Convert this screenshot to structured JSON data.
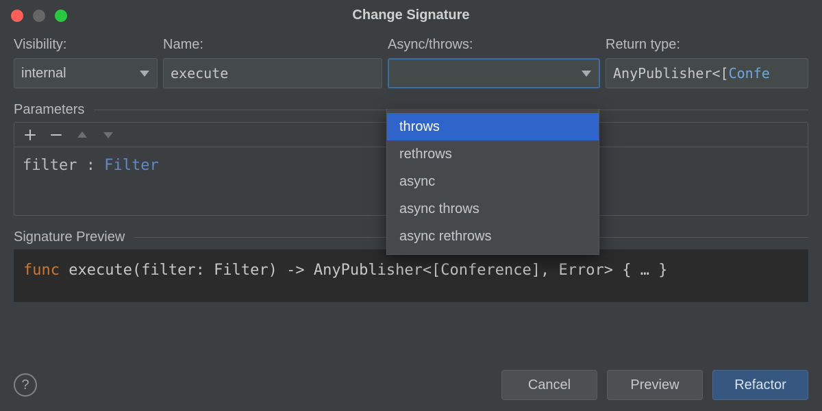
{
  "title": "Change Signature",
  "fields": {
    "visibility": {
      "label": "Visibility:",
      "value": "internal"
    },
    "name": {
      "label": "Name:",
      "value": "execute"
    },
    "async": {
      "label": "Async/throws:",
      "value": ""
    },
    "return": {
      "label": "Return type:",
      "value": "AnyPublisher<[Conference], Error>",
      "display": "AnyPublisher<[Confe"
    }
  },
  "async_options": [
    "throws",
    "rethrows",
    "async",
    "async throws",
    "async rethrows"
  ],
  "async_selected_index": 0,
  "sections": {
    "parameters": "Parameters",
    "preview": "Signature Preview"
  },
  "parameters": [
    {
      "name": "filter",
      "type": "Filter"
    }
  ],
  "preview": {
    "keyword": "func",
    "name": "execute",
    "params_text": "(filter: Filter)",
    "arrow": "->",
    "return_type": "AnyPublisher<[Conference], Error>",
    "body": "{ … }"
  },
  "buttons": {
    "cancel": "Cancel",
    "preview": "Preview",
    "refactor": "Refactor"
  }
}
